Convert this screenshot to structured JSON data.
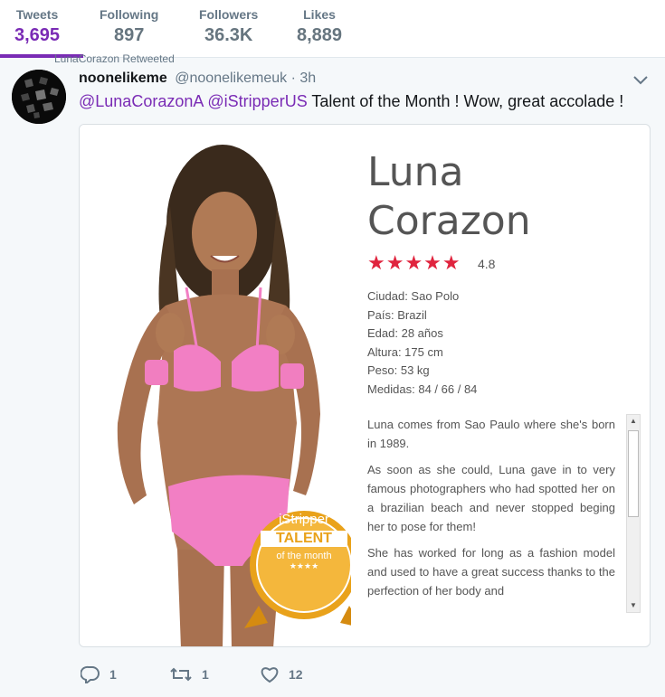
{
  "stats": [
    {
      "label": "Tweets",
      "value": "3,695",
      "active": true
    },
    {
      "label": "Following",
      "value": "897"
    },
    {
      "label": "Followers",
      "value": "36.3K"
    },
    {
      "label": "Likes",
      "value": "8,889"
    }
  ],
  "tweet": {
    "retweet_context": "LunaCorazon Retweeted",
    "display_name": "noonelikeme",
    "handle": "@noonelikemeuk",
    "separator": "·",
    "time": "3h",
    "mention_1": "@LunaCorazonA",
    "mention_2": "@iStripperUS",
    "text": "Talent of the Month ! Wow, great accolade !",
    "actions": {
      "replies": "1",
      "retweets": "1",
      "likes": "12"
    }
  },
  "card": {
    "name_line1": "Luna",
    "name_line2": "Corazon",
    "stars": "★★★★★",
    "rating": "4.8",
    "details": [
      "Ciudad: Sao Polo",
      "País: Brazil",
      "Edad: 28 años",
      "Altura: 175 cm",
      "Peso: 53 kg",
      "Medidas: 84 / 66 / 84"
    ],
    "bio": [
      "Luna comes from Sao Paulo where she's born in 1989.",
      "As soon as she could, Luna gave in to very famous photographers who had spotted her on a brazilian beach and never stopped beging her to pose for them!",
      "She has worked for long as a fashion model and used to have a great success thanks to the perfection of her body and"
    ],
    "badge": {
      "brand": "iStripper",
      "title": "TALENT",
      "subtitle": "of the month",
      "stars": "★★★★"
    }
  },
  "colors": {
    "accent": "#7a2bb5",
    "star": "#e0243e",
    "badge_gold": "#e9a21b"
  }
}
